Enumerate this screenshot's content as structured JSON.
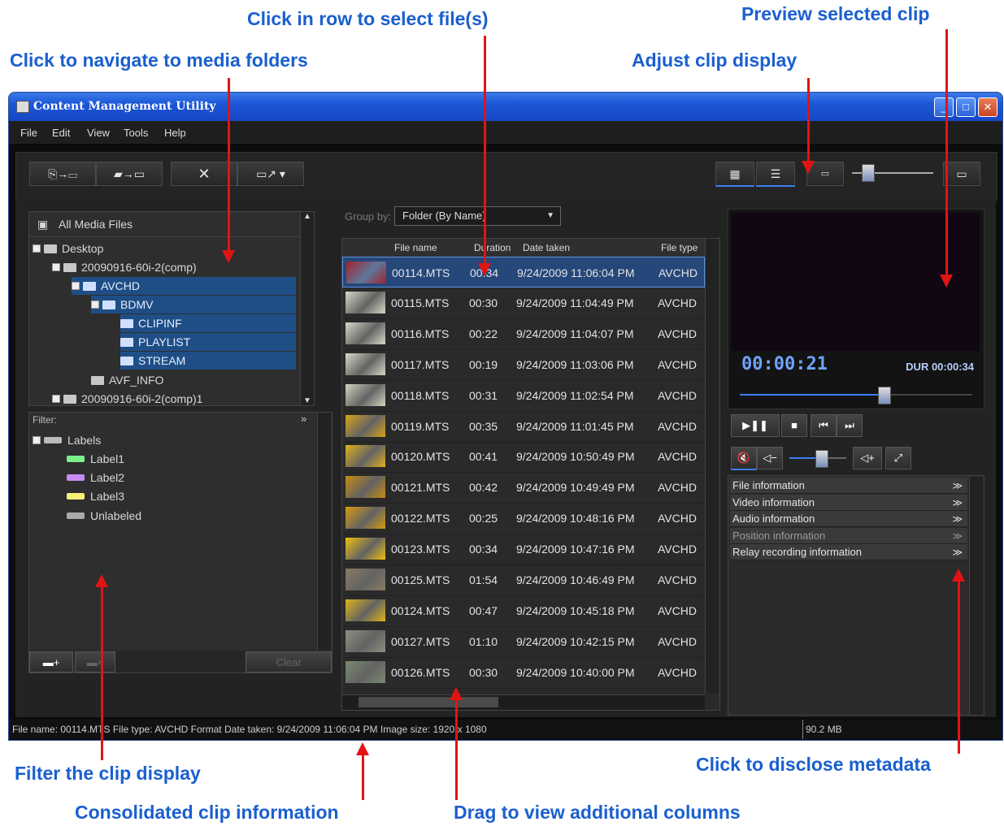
{
  "annotations": {
    "select_rows": "Click in row to select file(s)",
    "preview": "Preview selected clip",
    "navigate": "Click to navigate to media folders",
    "adjust": "Adjust clip display",
    "filter": "Filter the clip display",
    "disclose": "Click to disclose metadata",
    "consolidated": "Consolidated clip information",
    "drag": "Drag to view additional columns"
  },
  "window": {
    "title": "Content Management Utility",
    "menu": [
      "File",
      "Edit",
      "View",
      "Tools",
      "Help"
    ]
  },
  "toolbar": {
    "buttons": [
      "import-icon",
      "import-folder-icon",
      "delete-icon",
      "export-clip-icon"
    ],
    "view_buttons": [
      "grid-view-icon",
      "list-view-icon",
      "small-clip-icon",
      "large-clip-icon"
    ]
  },
  "tree": {
    "root": "All Media Files",
    "items": [
      "Desktop",
      "20090916-60i-2(comp)",
      "AVCHD",
      "BDMV",
      "CLIPINF",
      "PLAYLIST",
      "STREAM",
      "AVF_INFO",
      "20090916-60i-2(comp)1"
    ]
  },
  "filter": {
    "label": "Filter:",
    "group": "Labels",
    "items": [
      {
        "name": "Label1",
        "color": "#7cf08c"
      },
      {
        "name": "Label2",
        "color": "#c78cf0"
      },
      {
        "name": "Label3",
        "color": "#f5f078"
      },
      {
        "name": "Unlabeled",
        "color": "#aaaaaa"
      }
    ],
    "clear": "Clear"
  },
  "group_by": {
    "label": "Group by:",
    "value": "Folder (By Name)"
  },
  "columns": [
    "File name",
    "Duration",
    "Date taken",
    "File type"
  ],
  "files": [
    {
      "name": "00114.MTS",
      "duration": "00:34",
      "date": "9/24/2009 11:06:04 PM",
      "type": "AVCHD",
      "thumb": "#a0222a",
      "selected": true
    },
    {
      "name": "00115.MTS",
      "duration": "00:30",
      "date": "9/24/2009 11:04:49 PM",
      "type": "AVCHD",
      "thumb": "#d8d8c8"
    },
    {
      "name": "00116.MTS",
      "duration": "00:22",
      "date": "9/24/2009 11:04:07 PM",
      "type": "AVCHD",
      "thumb": "#d8d8c8"
    },
    {
      "name": "00117.MTS",
      "duration": "00:19",
      "date": "9/24/2009 11:03:06 PM",
      "type": "AVCHD",
      "thumb": "#d8d8c8"
    },
    {
      "name": "00118.MTS",
      "duration": "00:31",
      "date": "9/24/2009 11:02:54 PM",
      "type": "AVCHD",
      "thumb": "#d4d4c0"
    },
    {
      "name": "00119.MTS",
      "duration": "00:35",
      "date": "9/24/2009 11:01:45 PM",
      "type": "AVCHD",
      "thumb": "#d8a418"
    },
    {
      "name": "00120.MTS",
      "duration": "00:41",
      "date": "9/24/2009 10:50:49 PM",
      "type": "AVCHD",
      "thumb": "#e0b020"
    },
    {
      "name": "00121.MTS",
      "duration": "00:42",
      "date": "9/24/2009 10:49:49 PM",
      "type": "AVCHD",
      "thumb": "#c88a10"
    },
    {
      "name": "00122.MTS",
      "duration": "00:25",
      "date": "9/24/2009 10:48:16 PM",
      "type": "AVCHD",
      "thumb": "#d89a10"
    },
    {
      "name": "00123.MTS",
      "duration": "00:34",
      "date": "9/24/2009 10:47:16 PM",
      "type": "AVCHD",
      "thumb": "#f0c010"
    },
    {
      "name": "00125.MTS",
      "duration": "01:54",
      "date": "9/24/2009 10:46:49 PM",
      "type": "AVCHD",
      "thumb": "#8a7a66"
    },
    {
      "name": "00124.MTS",
      "duration": "00:47",
      "date": "9/24/2009 10:45:18 PM",
      "type": "AVCHD",
      "thumb": "#e0b418"
    },
    {
      "name": "00127.MTS",
      "duration": "01:10",
      "date": "9/24/2009 10:42:15 PM",
      "type": "AVCHD",
      "thumb": "#8a9080"
    },
    {
      "name": "00126.MTS",
      "duration": "00:30",
      "date": "9/24/2009 10:40:00 PM",
      "type": "AVCHD",
      "thumb": "#7a8a70"
    }
  ],
  "preview": {
    "timecode": "00:00:21",
    "duration": "DUR 00:00:34",
    "playback_position": 0.62,
    "volume": 0.55
  },
  "metadata_sections": [
    {
      "label": "File information",
      "enabled": true
    },
    {
      "label": "Video information",
      "enabled": true
    },
    {
      "label": "Audio information",
      "enabled": true
    },
    {
      "label": "Position information",
      "enabled": false
    },
    {
      "label": "Relay recording information",
      "enabled": true
    }
  ],
  "status": {
    "text": "File name: 00114.MTS  File type: AVCHD Format  Date taken: 9/24/2009 11:06:04 PM  Image size: 1920 x 1080",
    "size": "90.2 MB"
  },
  "colors": {
    "accent": "#3b7ff5",
    "selection": "#1f4e86",
    "annotation": "#1a5fd0",
    "arrow": "#e11414"
  }
}
